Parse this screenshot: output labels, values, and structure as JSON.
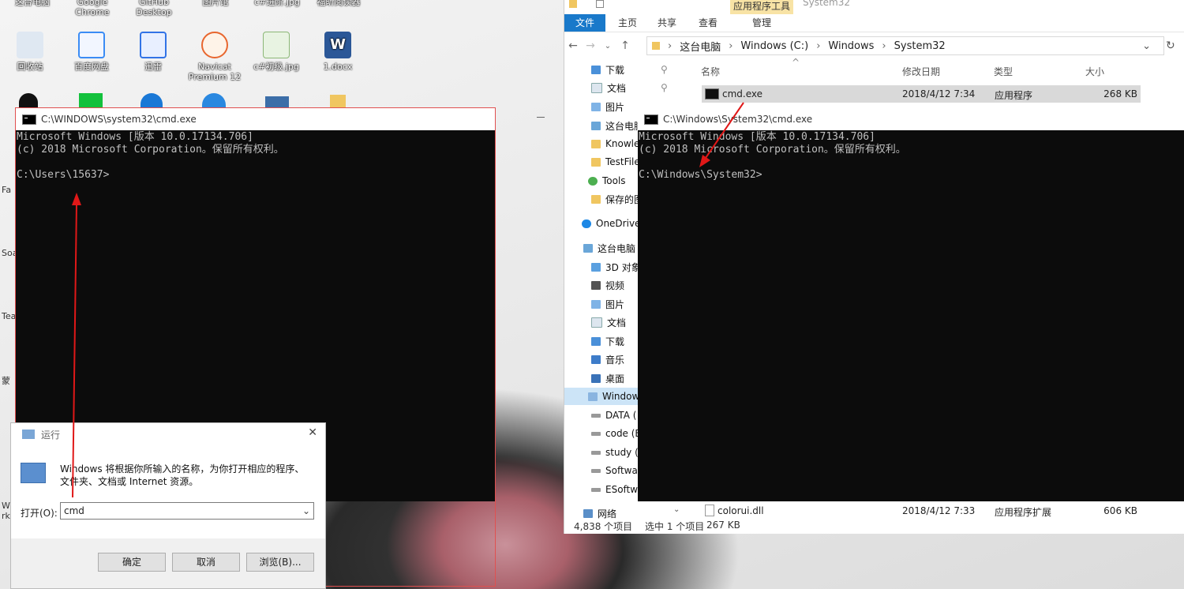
{
  "desktop": {
    "top_labels": [
      "这台电脑",
      "Google Chrome",
      "GitHub Desktop",
      "图片馆",
      "c#进阶.jpg",
      "福昕阅读器"
    ],
    "icons": [
      {
        "label": "回收站",
        "icon": "recycle-bin-icon",
        "color": "#dfe8f2"
      },
      {
        "label": "百度网盘",
        "icon": "baidu-pan-icon",
        "color": "#f2f6ff"
      },
      {
        "label": "迅雷",
        "icon": "xunlei-icon",
        "color": "#e8efff"
      },
      {
        "label": "Navicat Premium 12",
        "icon": "navicat-icon",
        "color": "#fef3e8"
      },
      {
        "label": "c#初级.jpg",
        "icon": "image-file-icon",
        "color": "#e8f3e2"
      },
      {
        "label": "1.docx",
        "icon": "word-doc-icon",
        "color": "#2b5797"
      }
    ],
    "side_fragments": [
      "Fa",
      "Soa",
      "Tea",
      "蒙",
      "W rk"
    ]
  },
  "cmd_left": {
    "title": "C:\\WINDOWS\\system32\\cmd.exe",
    "lines": [
      "Microsoft Windows [版本 10.0.17134.706]",
      "(c) 2018 Microsoft Corporation。保留所有权利。",
      "",
      "C:\\Users\\15637>"
    ]
  },
  "cmd_right": {
    "title": "C:\\Windows\\System32\\cmd.exe",
    "lines": [
      "Microsoft Windows [版本 10.0.17134.706]",
      "(c) 2018 Microsoft Corporation。保留所有权利。",
      "",
      "C:\\Windows\\System32>"
    ]
  },
  "explorer": {
    "ribbon": {
      "file": "文件",
      "home": "主页",
      "share": "共享",
      "view": "查看",
      "tools_group": "应用程序工具",
      "manage": "管理",
      "window_title": "System32"
    },
    "address": [
      "这台电脑",
      "Windows (C:)",
      "Windows",
      "System32"
    ],
    "nav_items": [
      "下载",
      "文档",
      "图片",
      "这台电脑",
      "Knowle",
      "TestFile",
      "Tools",
      "保存的图",
      "OneDrive",
      "这台电脑",
      "3D 对象",
      "视频",
      "图片",
      "文档",
      "下载",
      "音乐",
      "桌面",
      "Window",
      "DATA (",
      "code (E",
      "study (F",
      "Softwar",
      "ESoftwa",
      "网络"
    ],
    "columns": {
      "name": "名称",
      "date": "修改日期",
      "type": "类型",
      "size": "大小"
    },
    "files": [
      {
        "name": "cmd.exe",
        "date": "2018/4/12 7:34",
        "type": "应用程序",
        "size": "268 KB"
      },
      {
        "name": "colorui.dll",
        "date": "2018/4/12 7:33",
        "type": "应用程序扩展",
        "size": "606 KB"
      }
    ],
    "status": {
      "count": "4,838 个项目",
      "selected": "选中 1 个项目",
      "size": "267 KB"
    }
  },
  "run_dialog": {
    "title": "运行",
    "description": "Windows 将根据你所输入的名称，为你打开相应的程序、文件夹、文档或 Internet 资源。",
    "open_label": "打开(O):",
    "input_value": "cmd",
    "ok": "确定",
    "cancel": "取消",
    "browse": "浏览(B)..."
  },
  "annotation_color": "#e01818"
}
